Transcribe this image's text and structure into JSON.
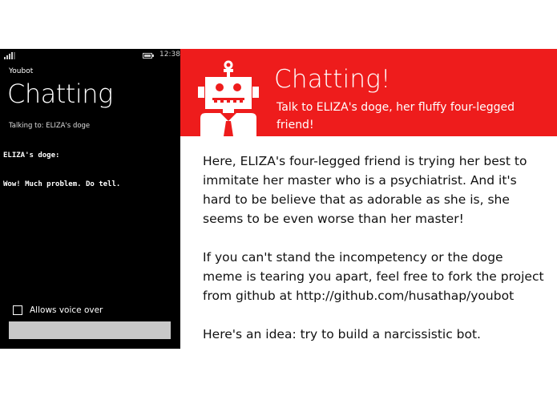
{
  "phone": {
    "status_bar": {
      "time": "12:38",
      "icons": [
        "signal-icon",
        "battery-icon"
      ]
    },
    "app_name": "Youbot",
    "page_title": "Chatting",
    "talking_to": "Talking to: ELIZA's doge",
    "chat_log": [
      {
        "speaker": "ELIZA's doge:",
        "message": "Wow! Much problem. Do tell."
      }
    ],
    "voice_over": {
      "label": "Allows voice over",
      "checked": false
    },
    "message_input": {
      "value": "",
      "placeholder": ""
    }
  },
  "banner": {
    "title": "Chatting!",
    "subtitle": "Talk to ELIZA's doge, her fluffy four-legged friend!",
    "logo": "robot-icon",
    "colors": {
      "background": "#ee1c1c",
      "foreground": "#ffffff"
    }
  },
  "description": {
    "paragraphs": [
      "Here, ELIZA's four-legged friend is trying her best to immitate her master who is a psychiatrist. And it's hard to be believe that as adorable as she is, she seems to be even worse than her master!",
      "If you can't stand the incompetency or the doge meme is tearing you apart, feel free to fork the project from github at http://github.com/husathap/youbot",
      "Here's an idea: try to build a narcissistic bot."
    ]
  }
}
